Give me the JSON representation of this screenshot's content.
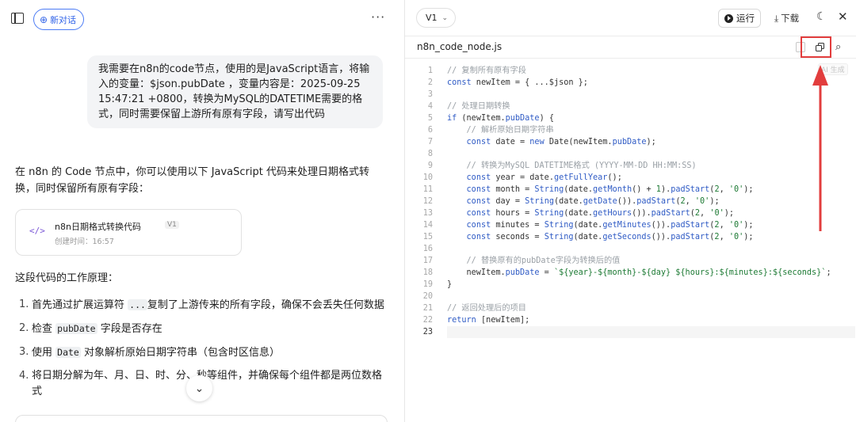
{
  "left": {
    "new_chat_label": "新对话",
    "user_message": "我需要在n8n的code节点，使用的是JavaScript语言，将输入的变量：$json.pubDate ，变量内容是：2025-09-25 15:47:21 +0800，转换为MySQL的DATETIME需要的格式，同时需要保留上游所有原有字段，请写出代码",
    "answer_intro": "在 n8n 的 Code 节点中，你可以使用以下 JavaScript 代码来处理日期格式转换，同时保留所有原有字段：",
    "artifact": {
      "title": "n8n日期格式转换代码",
      "version": "V1",
      "time": "创建时间：16:57",
      "icon": "code-icon"
    },
    "principle_title": "这段代码的工作原理：",
    "steps": [
      {
        "num": "1.",
        "pre": "首先通过扩展运算符 ",
        "code": "...",
        "post": "复制了上游传来的所有字段，确保不会丢失任何数据"
      },
      {
        "num": "2.",
        "pre": "检查 ",
        "code": "pubDate",
        "post": " 字段是否存在"
      },
      {
        "num": "3.",
        "pre": "使用 ",
        "code": "Date",
        "post": " 对象解析原始日期字符串（包含时区信息）"
      },
      {
        "num": "4.",
        "pre": "将日期分解为年、月、日、时、分、秒等组件，并确保每个组件都是两位数格式",
        "code": "",
        "post": ""
      }
    ]
  },
  "right": {
    "version_label": "V1",
    "run_label": "运行",
    "download_label": "下载",
    "file_name": "n8n_code_node.js",
    "ai_badge": "AI 生成",
    "accent_red": "#e23d3d",
    "code_lines": [
      {
        "n": "1",
        "html": "<span class=\"tk-c\">// 复制所有原有字段</span>"
      },
      {
        "n": "2",
        "html": "<span class=\"tk-k\">const</span> newItem = { ...$json };"
      },
      {
        "n": "3",
        "html": ""
      },
      {
        "n": "4",
        "html": "<span class=\"tk-c\">// 处理日期转换</span>"
      },
      {
        "n": "5",
        "html": "<span class=\"tk-k\">if</span> (newItem.<span class=\"tk-p\">pubDate</span>) {"
      },
      {
        "n": "6",
        "html": "    <span class=\"tk-c\">// 解析原始日期字符串</span>"
      },
      {
        "n": "7",
        "html": "    <span class=\"tk-k\">const</span> date = <span class=\"tk-k\">new</span> Date(newItem.<span class=\"tk-p\">pubDate</span>);"
      },
      {
        "n": "8",
        "html": ""
      },
      {
        "n": "9",
        "html": "    <span class=\"tk-c\">// 转换为MySQL DATETIME格式 (YYYY-MM-DD HH:MM:SS)</span>"
      },
      {
        "n": "10",
        "html": "    <span class=\"tk-k\">const</span> year = date.<span class=\"tk-f\">getFullYear</span>();"
      },
      {
        "n": "11",
        "html": "    <span class=\"tk-k\">const</span> month = <span class=\"tk-t\">String</span>(date.<span class=\"tk-f\">getMonth</span>() + <span class=\"tk-n\">1</span>).<span class=\"tk-f\">padStart</span>(<span class=\"tk-n\">2</span>, <span class=\"tk-s\">'0'</span>);"
      },
      {
        "n": "12",
        "html": "    <span class=\"tk-k\">const</span> day = <span class=\"tk-t\">String</span>(date.<span class=\"tk-f\">getDate</span>()).<span class=\"tk-f\">padStart</span>(<span class=\"tk-n\">2</span>, <span class=\"tk-s\">'0'</span>);"
      },
      {
        "n": "13",
        "html": "    <span class=\"tk-k\">const</span> hours = <span class=\"tk-t\">String</span>(date.<span class=\"tk-f\">getHours</span>()).<span class=\"tk-f\">padStart</span>(<span class=\"tk-n\">2</span>, <span class=\"tk-s\">'0'</span>);"
      },
      {
        "n": "14",
        "html": "    <span class=\"tk-k\">const</span> minutes = <span class=\"tk-t\">String</span>(date.<span class=\"tk-f\">getMinutes</span>()).<span class=\"tk-f\">padStart</span>(<span class=\"tk-n\">2</span>, <span class=\"tk-s\">'0'</span>);"
      },
      {
        "n": "15",
        "html": "    <span class=\"tk-k\">const</span> seconds = <span class=\"tk-t\">String</span>(date.<span class=\"tk-f\">getSeconds</span>()).<span class=\"tk-f\">padStart</span>(<span class=\"tk-n\">2</span>, <span class=\"tk-s\">'0'</span>);"
      },
      {
        "n": "16",
        "html": ""
      },
      {
        "n": "17",
        "html": "    <span class=\"tk-c\">// 替换原有的pubDate字段为转换后的值</span>"
      },
      {
        "n": "18",
        "html": "    newItem.<span class=\"tk-p\">pubDate</span> = <span class=\"tk-s\">`${year}-${month}-${day} ${hours}:${minutes}:${seconds}`</span>;"
      },
      {
        "n": "19",
        "html": "}"
      },
      {
        "n": "20",
        "html": ""
      },
      {
        "n": "21",
        "html": "<span class=\"tk-c\">// 返回处理后的项目</span>"
      },
      {
        "n": "22",
        "html": "<span class=\"tk-k\">return</span> [newItem];"
      },
      {
        "n": "23",
        "html": ""
      }
    ]
  }
}
